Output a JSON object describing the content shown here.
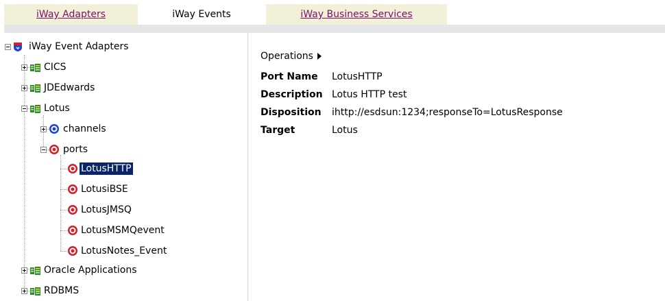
{
  "tabs": [
    {
      "label": "iWay Adapters",
      "active": false
    },
    {
      "label": "iWay Events",
      "active": true
    },
    {
      "label": "iWay Business Services",
      "active": false
    }
  ],
  "tree": {
    "root": "iWay Event Adapters",
    "items": {
      "cics": "CICS",
      "jdedwards": "JDEdwards",
      "lotus": "Lotus",
      "channels": "channels",
      "ports": "ports",
      "port1": "LotusHTTP",
      "port2": "LotusiBSE",
      "port3": "LotusJMSQ",
      "port4": "LotusMSMQevent",
      "port5": "LotusNotes_Event",
      "oracle": "Oracle Applications",
      "rdbms": "RDBMS"
    },
    "selected": "LotusHTTP"
  },
  "details": {
    "operations_label": "Operations",
    "props": [
      {
        "key": "Port Name",
        "value": "LotusHTTP"
      },
      {
        "key": "Description",
        "value": "Lotus HTTP test"
      },
      {
        "key": "Disposition",
        "value": "ihttp://esdsun:1234;responseTo=LotusResponse"
      },
      {
        "key": "Target",
        "value": "Lotus"
      }
    ]
  },
  "colors": {
    "tab_link_text": "#7a0f6a",
    "tab_link_bg": "#f3f0d9",
    "selection_bg": "#0a246a",
    "adapter_icon": "#2e8b2e",
    "port_icon": "#d0202a",
    "channel_icon": "#2244cc"
  }
}
